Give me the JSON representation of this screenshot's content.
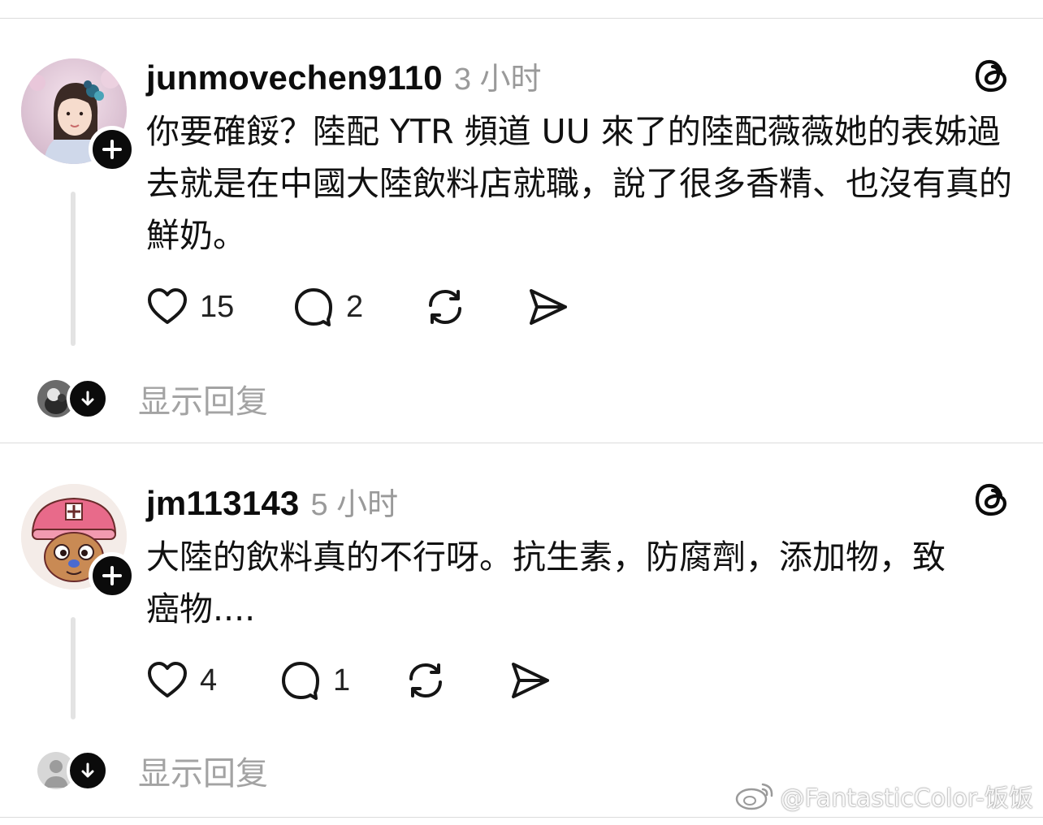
{
  "posts": [
    {
      "username": "junmovechen9110",
      "time": "3 小时",
      "text": "你要確餒？陸配 YTR 頻道 UU 來了的陸配薇薇她的表姊過去就是在中國大陸飲料店就職，說了很多香精、也沒有真的鮮奶。",
      "likes": "15",
      "comments": "2",
      "show_replies": "显示回复",
      "avatar_icon": "profile-photo-girl"
    },
    {
      "username": "jm113143",
      "time": "5 小时",
      "text": "大陸的飲料真的不行呀。抗生素，防腐劑，添加物，致癌物....",
      "likes": "4",
      "comments": "1",
      "show_replies": "显示回复",
      "avatar_icon": "profile-photo-chopper"
    }
  ],
  "watermark": "@FantasticColor-饭饭",
  "icons": {
    "follow": "plus-icon",
    "threads": "threads-logo-icon",
    "like": "heart-icon",
    "comment": "comment-bubble-icon",
    "repost": "repost-icon",
    "share": "send-icon",
    "expand": "arrow-down-icon"
  }
}
